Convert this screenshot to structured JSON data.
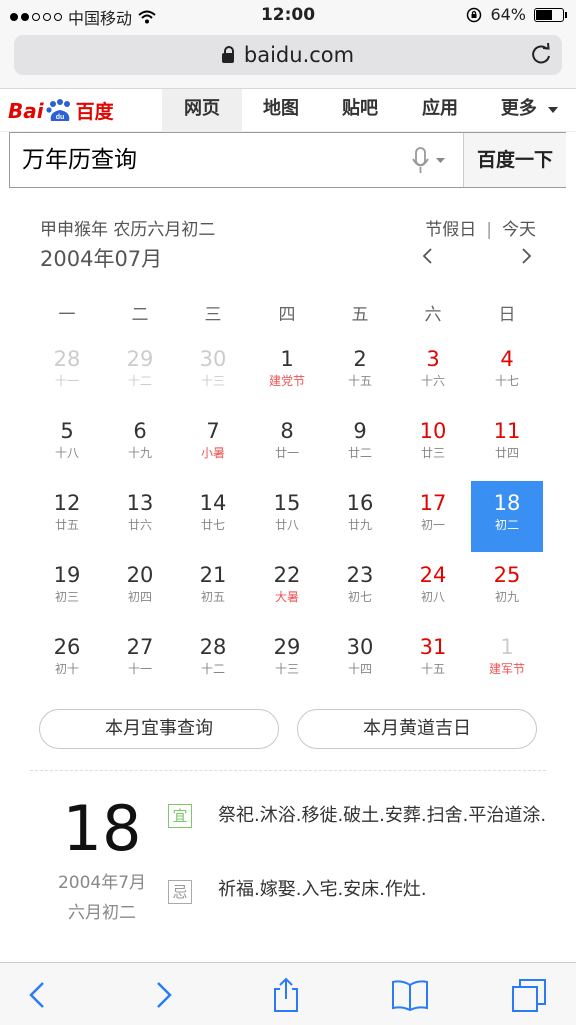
{
  "status": {
    "carrier": "中国移动",
    "time": "12:00",
    "battery": "64%",
    "battery_level": 0.64
  },
  "browser": {
    "url": "baidu.com"
  },
  "nav": {
    "logo_latin_1": "Bai",
    "logo_latin_2": "du",
    "logo_cn": "百度",
    "items": [
      "网页",
      "地图",
      "贴吧",
      "应用",
      "更多"
    ]
  },
  "search": {
    "query": "万年历查询",
    "button": "百度一下"
  },
  "calendar": {
    "header_ganzhi": "甲申猴年  农历六月初二",
    "month_title": "2004年07月",
    "holiday_label": "节假日",
    "today_label": "今天",
    "weekdays": [
      "一",
      "二",
      "三",
      "四",
      "五",
      "六",
      "日"
    ],
    "weeks": [
      [
        {
          "d": "28",
          "l": "十一",
          "o": true
        },
        {
          "d": "29",
          "l": "十二",
          "o": true
        },
        {
          "d": "30",
          "l": "十三",
          "o": true
        },
        {
          "d": "1",
          "l": "建党节",
          "f": true
        },
        {
          "d": "2",
          "l": "十五"
        },
        {
          "d": "3",
          "l": "十六"
        },
        {
          "d": "4",
          "l": "十七"
        }
      ],
      [
        {
          "d": "5",
          "l": "十八"
        },
        {
          "d": "6",
          "l": "十九"
        },
        {
          "d": "7",
          "l": "小暑",
          "f": true
        },
        {
          "d": "8",
          "l": "廿一"
        },
        {
          "d": "9",
          "l": "廿二"
        },
        {
          "d": "10",
          "l": "廿三"
        },
        {
          "d": "11",
          "l": "廿四"
        }
      ],
      [
        {
          "d": "12",
          "l": "廿五"
        },
        {
          "d": "13",
          "l": "廿六"
        },
        {
          "d": "14",
          "l": "廿七"
        },
        {
          "d": "15",
          "l": "廿八"
        },
        {
          "d": "16",
          "l": "廿九"
        },
        {
          "d": "17",
          "l": "初一"
        },
        {
          "d": "18",
          "l": "初二",
          "s": true
        }
      ],
      [
        {
          "d": "19",
          "l": "初三"
        },
        {
          "d": "20",
          "l": "初四"
        },
        {
          "d": "21",
          "l": "初五"
        },
        {
          "d": "22",
          "l": "大暑",
          "f": true
        },
        {
          "d": "23",
          "l": "初七"
        },
        {
          "d": "24",
          "l": "初八"
        },
        {
          "d": "25",
          "l": "初九"
        }
      ],
      [
        {
          "d": "26",
          "l": "初十"
        },
        {
          "d": "27",
          "l": "十一"
        },
        {
          "d": "28",
          "l": "十二"
        },
        {
          "d": "29",
          "l": "十三"
        },
        {
          "d": "30",
          "l": "十四"
        },
        {
          "d": "31",
          "l": "十五"
        },
        {
          "d": "1",
          "l": "建军节",
          "o": true,
          "f": true
        }
      ]
    ],
    "btn_yishi": "本月宜事查询",
    "btn_huangdao": "本月黄道吉日"
  },
  "detail": {
    "day": "18",
    "solar": "2004年7月",
    "lunar": "六月初二",
    "yi_label": "宜",
    "yi": "祭祀.沐浴.移徙.破土.安葬.扫舍.平治道涂.",
    "ji_label": "忌",
    "ji": "祈福.嫁娶.入宅.安床.作灶."
  },
  "colors": {
    "accent": "#3a8ff2",
    "red": "#e10601",
    "festival": "#ee5555",
    "yi": "#7ec86b"
  }
}
